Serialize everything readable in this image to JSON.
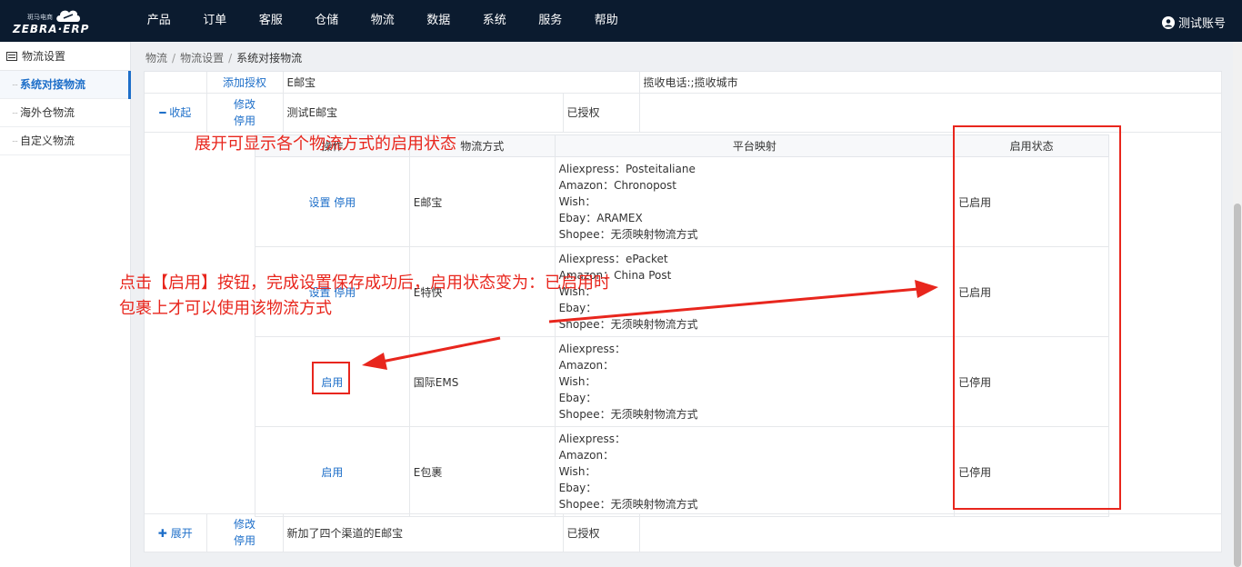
{
  "header": {
    "logo_text": "ZEBRA·ERP",
    "logo_sub": "斑马电商",
    "nav": [
      "产品",
      "订单",
      "客服",
      "仓储",
      "物流",
      "数据",
      "系统",
      "服务",
      "帮助"
    ],
    "account": "测试账号"
  },
  "sidebar": {
    "title": "物流设置",
    "items": [
      {
        "label": "系统对接物流",
        "active": true
      },
      {
        "label": "海外仓物流",
        "active": false
      },
      {
        "label": "自定义物流",
        "active": false
      }
    ]
  },
  "breadcrumb": [
    "物流",
    "物流设置",
    "系统对接物流"
  ],
  "rows": {
    "row1": {
      "action": "添加授权",
      "name": "E邮宝",
      "info": "揽收电话:;揽收城市"
    },
    "row2": {
      "toggle": "收起",
      "edit": "修改",
      "disable": "停用",
      "name": "测试E邮宝",
      "status": "已授权"
    },
    "row3": {
      "toggle": "展开",
      "edit": "修改",
      "disable": "停用",
      "name": "新加了四个渠道的E邮宝",
      "status": "已授权"
    }
  },
  "sub_table": {
    "headers": [
      "操作",
      "物流方式",
      "平台映射",
      "启用状态"
    ],
    "rows": [
      {
        "actions": "设置 停用",
        "method": "E邮宝",
        "mapping": [
          "Aliexpress：Posteitaliane",
          "Amazon：Chronopost",
          "Wish：",
          "Ebay：ARAMEX",
          "Shopee：无须映射物流方式"
        ],
        "status": "已启用"
      },
      {
        "actions": "设置 停用",
        "method": "E特快",
        "mapping": [
          "Aliexpress：ePacket",
          "Amazon：China Post",
          "Wish：",
          "Ebay：",
          "Shopee：无须映射物流方式"
        ],
        "status": "已启用"
      },
      {
        "actions": "启用",
        "method": "国际EMS",
        "mapping": [
          "Aliexpress：",
          "Amazon：",
          "Wish：",
          "Ebay：",
          "Shopee：无须映射物流方式"
        ],
        "status": "已停用"
      },
      {
        "actions": "启用",
        "method": "E包裹",
        "mapping": [
          "Aliexpress：",
          "Amazon：",
          "Wish：",
          "Ebay：",
          "Shopee：无须映射物流方式"
        ],
        "status": "已停用"
      }
    ]
  },
  "annotations": {
    "note1": "展开可显示各个物流方式的启用状态",
    "note2_line1": "点击【启用】按钮，完成设置保存成功后，启用状态变为：已启用时",
    "note2_line2": "包裹上才可以使用该物流方式"
  },
  "colors": {
    "annotation": "#e8261d",
    "link": "#1e6fc9",
    "topbar": "#0b1b2f"
  }
}
